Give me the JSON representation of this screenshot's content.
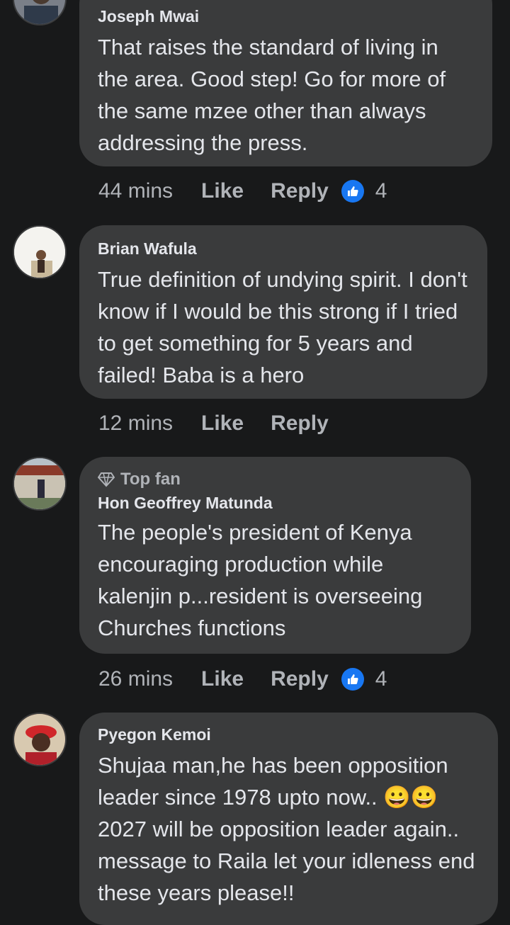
{
  "comments": [
    {
      "author": "Joseph Mwai",
      "text": "That raises the standard of living in the area. Good step! Go for more of the same mzee other than always addressing the press.",
      "time": "44 mins",
      "like_label": "Like",
      "reply_label": "Reply",
      "reaction_count": "4"
    },
    {
      "author": "Brian Wafula",
      "text": "True definition of undying spirit. I don't know if I would be this strong if I tried to get something for 5 years and failed! Baba is a hero",
      "time": "12 mins",
      "like_label": "Like",
      "reply_label": "Reply"
    },
    {
      "badge": "Top fan",
      "author": "Hon Geoffrey Matunda",
      "text": "The people's president of Kenya encouraging production while kalenjin p...resident is overseeing Churches functions",
      "time": "26 mins",
      "like_label": "Like",
      "reply_label": "Reply",
      "reaction_count": "4"
    },
    {
      "author": "Pyegon Kemoi",
      "text": "Shujaa man,he has been opposition leader since 1978 upto now.. 😀😀2027 will be opposition leader again.. message to Raila let your idleness end these years please!!"
    }
  ],
  "colors": {
    "background": "#18191a",
    "bubble": "#3a3b3c",
    "text": "#e4e6eb",
    "muted": "#b0b3b8",
    "like_blue": "#1877f2"
  }
}
